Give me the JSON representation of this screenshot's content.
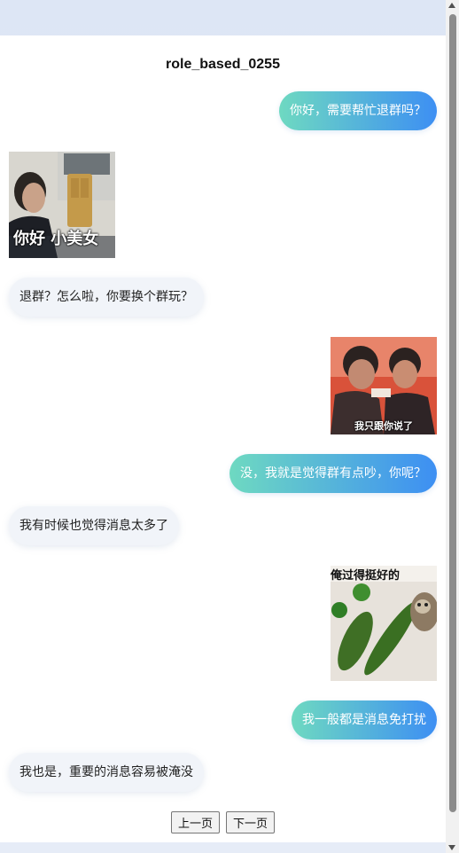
{
  "page_title": "role_based_0255",
  "messages": [
    {
      "sender": "me",
      "type": "text",
      "text": "你好，需要帮忙退群吗？"
    },
    {
      "sender": "other",
      "type": "sticker",
      "caption": "你好 小美女"
    },
    {
      "sender": "other",
      "type": "text",
      "text": "退群？怎么啦，你要换个群玩？"
    },
    {
      "sender": "me",
      "type": "sticker",
      "caption": "我只跟你说了"
    },
    {
      "sender": "me",
      "type": "text",
      "text": "没，我就是觉得群有点吵，你呢？"
    },
    {
      "sender": "other",
      "type": "text",
      "text": "我有时候也觉得消息太多了"
    },
    {
      "sender": "me",
      "type": "sticker",
      "caption": "俺过得挺好的"
    },
    {
      "sender": "me",
      "type": "text",
      "text": "我一般都是消息免打扰"
    },
    {
      "sender": "other",
      "type": "text",
      "text": "我也是，重要的消息容易被淹没"
    }
  ],
  "pager": {
    "prev": "上一页",
    "next": "下一页"
  },
  "colors": {
    "my_bubble_start": "#6ed9c1",
    "my_bubble_end": "#3d8ff3",
    "other_bubble": "#f1f4f9"
  }
}
